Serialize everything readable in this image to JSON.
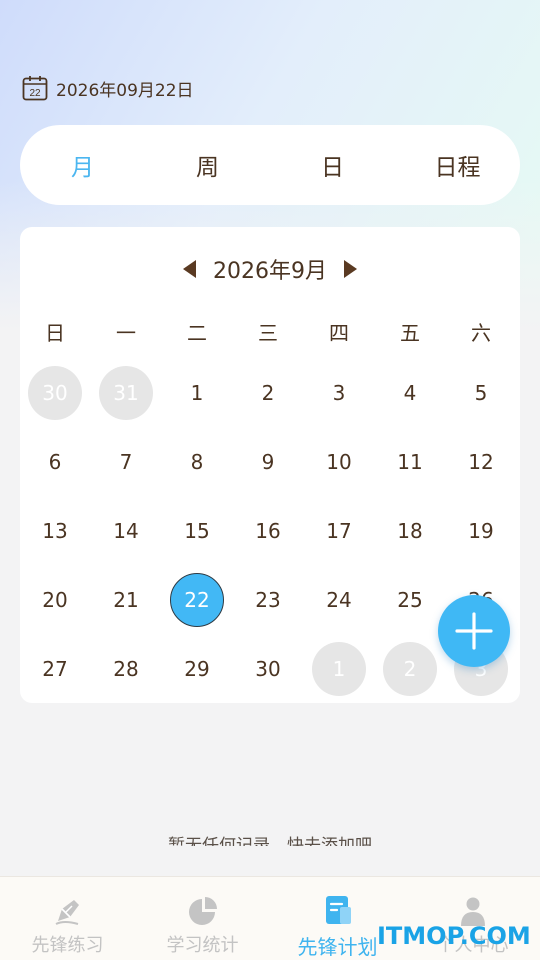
{
  "header": {
    "current_date": "2026年09月22日",
    "calendar_icon_day": "22"
  },
  "view_tabs": [
    {
      "label": "月",
      "active": true
    },
    {
      "label": "周",
      "active": false
    },
    {
      "label": "日",
      "active": false
    },
    {
      "label": "日程",
      "active": false
    }
  ],
  "calendar": {
    "month_title": "2026年9月",
    "weekdays": [
      "日",
      "一",
      "二",
      "三",
      "四",
      "五",
      "六"
    ],
    "weeks": [
      [
        {
          "d": "30",
          "other": true
        },
        {
          "d": "31",
          "other": true
        },
        {
          "d": "1"
        },
        {
          "d": "2"
        },
        {
          "d": "3"
        },
        {
          "d": "4"
        },
        {
          "d": "5"
        }
      ],
      [
        {
          "d": "6"
        },
        {
          "d": "7"
        },
        {
          "d": "8"
        },
        {
          "d": "9"
        },
        {
          "d": "10"
        },
        {
          "d": "11"
        },
        {
          "d": "12"
        }
      ],
      [
        {
          "d": "13"
        },
        {
          "d": "14"
        },
        {
          "d": "15"
        },
        {
          "d": "16"
        },
        {
          "d": "17"
        },
        {
          "d": "18"
        },
        {
          "d": "19"
        }
      ],
      [
        {
          "d": "20"
        },
        {
          "d": "21"
        },
        {
          "d": "22",
          "selected": true
        },
        {
          "d": "23"
        },
        {
          "d": "24"
        },
        {
          "d": "25"
        },
        {
          "d": "26"
        }
      ],
      [
        {
          "d": "27"
        },
        {
          "d": "28"
        },
        {
          "d": "29"
        },
        {
          "d": "30"
        },
        {
          "d": "1",
          "other": true
        },
        {
          "d": "2",
          "other": true
        },
        {
          "d": "3",
          "other": true
        }
      ]
    ]
  },
  "hint": "暂无任何记录，快去添加吧",
  "bottom_nav": [
    {
      "label": "先锋练习",
      "icon": "pen-icon",
      "active": false
    },
    {
      "label": "学习统计",
      "icon": "pie-chart-icon",
      "active": false
    },
    {
      "label": "先锋计划",
      "icon": "notebook-icon",
      "active": true
    },
    {
      "label": "个人中心",
      "icon": "person-icon",
      "active": false
    }
  ],
  "watermark": "ITMOP.COM",
  "colors": {
    "accent": "#3fb8f5",
    "text": "#4a3422",
    "other_month_bg": "#e6e6e6",
    "inactive_nav": "#c3c3c3"
  }
}
